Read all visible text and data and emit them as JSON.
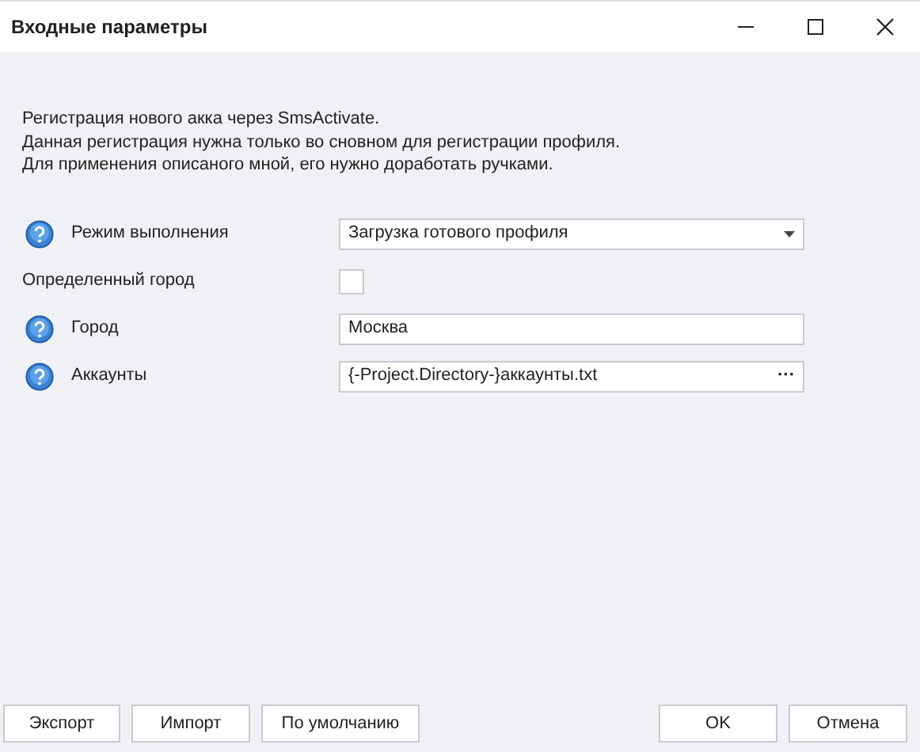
{
  "window": {
    "title": "Входные параметры"
  },
  "description": [
    "Регистрация нового акка через SmsActivate.",
    "Данная регистрация нужна только во сновном для регистрации профиля.",
    "Для применения описаного мной, его нужно доработать ручками."
  ],
  "fields": [
    {
      "kind": "select",
      "help": true,
      "label": "Режим выполнения",
      "value": "Загрузка готового профиля"
    },
    {
      "kind": "checkbox",
      "help": false,
      "label": "Определенный город",
      "checked": false
    },
    {
      "kind": "text",
      "help": true,
      "label": "Город",
      "value": "Москва"
    },
    {
      "kind": "file",
      "help": true,
      "label": "Аккаунты",
      "value": "{-Project.Directory-}аккаунты.txt",
      "browse": "···"
    }
  ],
  "left_buttons": [
    "Экспорт",
    "Импорт",
    "По умолчанию"
  ],
  "right_buttons": [
    "OK",
    "Отмена"
  ]
}
